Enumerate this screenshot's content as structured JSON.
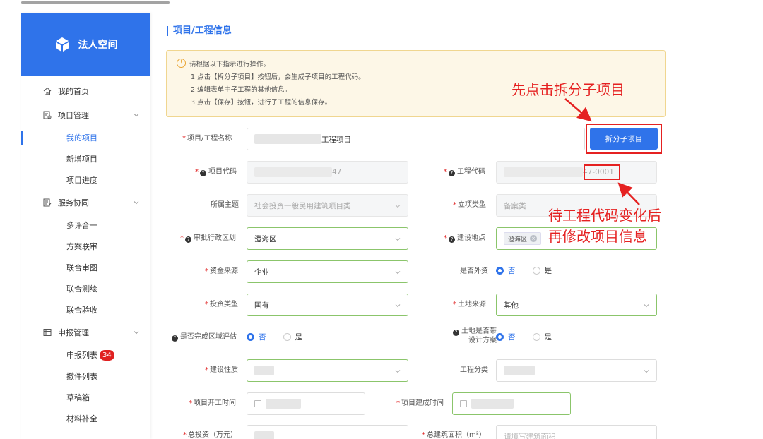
{
  "brand": {
    "name": "法人空间",
    "logo_icon": "cube-icon"
  },
  "sidebar": {
    "groups": [
      {
        "label": "我的首页",
        "icon": "home-icon"
      },
      {
        "label": "项目管理",
        "icon": "project-icon",
        "items": [
          "我的项目",
          "新增项目",
          "项目进度"
        ]
      },
      {
        "label": "服务协同",
        "icon": "service-icon",
        "items": [
          "多评合一",
          "方案联审",
          "联合审图",
          "联合测绘",
          "联合验收"
        ]
      },
      {
        "label": "申报管理",
        "icon": "apply-icon",
        "items": [
          "申报列表",
          "撤件列表",
          "草稿箱",
          "材料补全"
        ]
      }
    ],
    "active_item": "我的项目",
    "badge_count": "34"
  },
  "section_title": "项目/工程信息",
  "notice": {
    "title": "请根据以下指示进行操作。",
    "steps": [
      "1.点击【拆分子项目】按钮后，会生成子项目的工程代码。",
      "2.编辑表单中子工程的其他信息。",
      "3.点击【保存】按钮，进行子工程的信息保存。"
    ]
  },
  "form": {
    "project_name": {
      "label": "项目/工程名称",
      "value_suffix": "工程项目"
    },
    "split_button": "拆分子项目",
    "project_code": {
      "label": "项目代码",
      "value_suffix": "47"
    },
    "engineering_code": {
      "label": "工程代码",
      "value_suffix": "47-0001"
    },
    "subject": {
      "label": "所属主题",
      "value": "社会投资一般民用建筑项目类"
    },
    "approval_type": {
      "label": "立项类型",
      "value": "备案类"
    },
    "district": {
      "label": "审批行政区划",
      "value": "澄海区"
    },
    "location": {
      "label": "建设地点",
      "tag": "澄海区"
    },
    "fund_source": {
      "label": "资金来源",
      "value": "企业"
    },
    "foreign_capital": {
      "label": "是否外资",
      "options": [
        "否",
        "是"
      ],
      "selected": "否"
    },
    "investment_type": {
      "label": "投资类型",
      "value": "国有"
    },
    "land_source": {
      "label": "土地来源",
      "value": "其他"
    },
    "regional_assessment": {
      "label": "是否完成区域评估",
      "options": [
        "否",
        "是"
      ],
      "selected": "否"
    },
    "land_with_design": {
      "label_line1": "土地是否带",
      "label_line2": "设计方案",
      "options": [
        "否",
        "是"
      ],
      "selected": "否"
    },
    "construction_nature": {
      "label": "建设性质"
    },
    "engineering_category": {
      "label": "工程分类"
    },
    "start_time": {
      "label": "项目开工时间"
    },
    "completion_time": {
      "label": "项目建成时间"
    },
    "total_investment": {
      "label": "总投资（万元）"
    },
    "total_area": {
      "label": "总建筑面积（m²）",
      "placeholder": "请填写建筑面积"
    }
  },
  "annotations": {
    "click_split": "先点击拆分子项目",
    "wait_line1": "待工程代码变化后",
    "wait_line2": "再修改项目信息",
    "color": "#e52121"
  },
  "colors": {
    "primary": "#2f73ea",
    "warning_bg": "#fdf7e7",
    "required": "#e02020"
  }
}
